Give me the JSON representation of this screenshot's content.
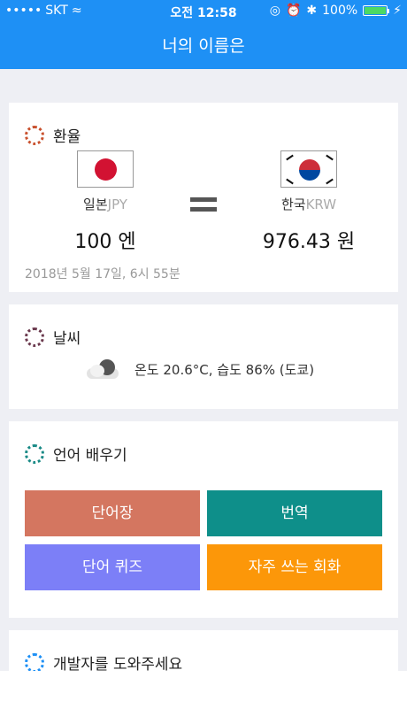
{
  "status_bar": {
    "carrier": "SKT",
    "time": "오전 12:58",
    "battery": "100%",
    "battery_level": 1.0
  },
  "nav": {
    "title": "너의 이름은"
  },
  "exchange": {
    "title": "환율",
    "ring_color": "#c9512e",
    "from": {
      "country": "일본",
      "code": "JPY",
      "amount": "100 엔"
    },
    "to": {
      "country": "한국",
      "code": "KRW",
      "amount": "976.43 원"
    },
    "updated": "2018년 5월 17일, 6시 55분"
  },
  "weather": {
    "title": "날씨",
    "ring_color": "#6b3a4e",
    "icon": "cloud-icon",
    "summary": "온도 20.6°C,  습도 86% (도쿄)"
  },
  "language": {
    "title": "언어 배우기",
    "ring_color": "#1a8a86",
    "buttons": {
      "vocab": "단어장",
      "translate": "번역",
      "quiz": "단어 퀴즈",
      "phrases": "자주 쓰는 회화"
    }
  },
  "developer": {
    "title": "개발자를 도와주세요",
    "ring_color": "#1e90f5"
  }
}
